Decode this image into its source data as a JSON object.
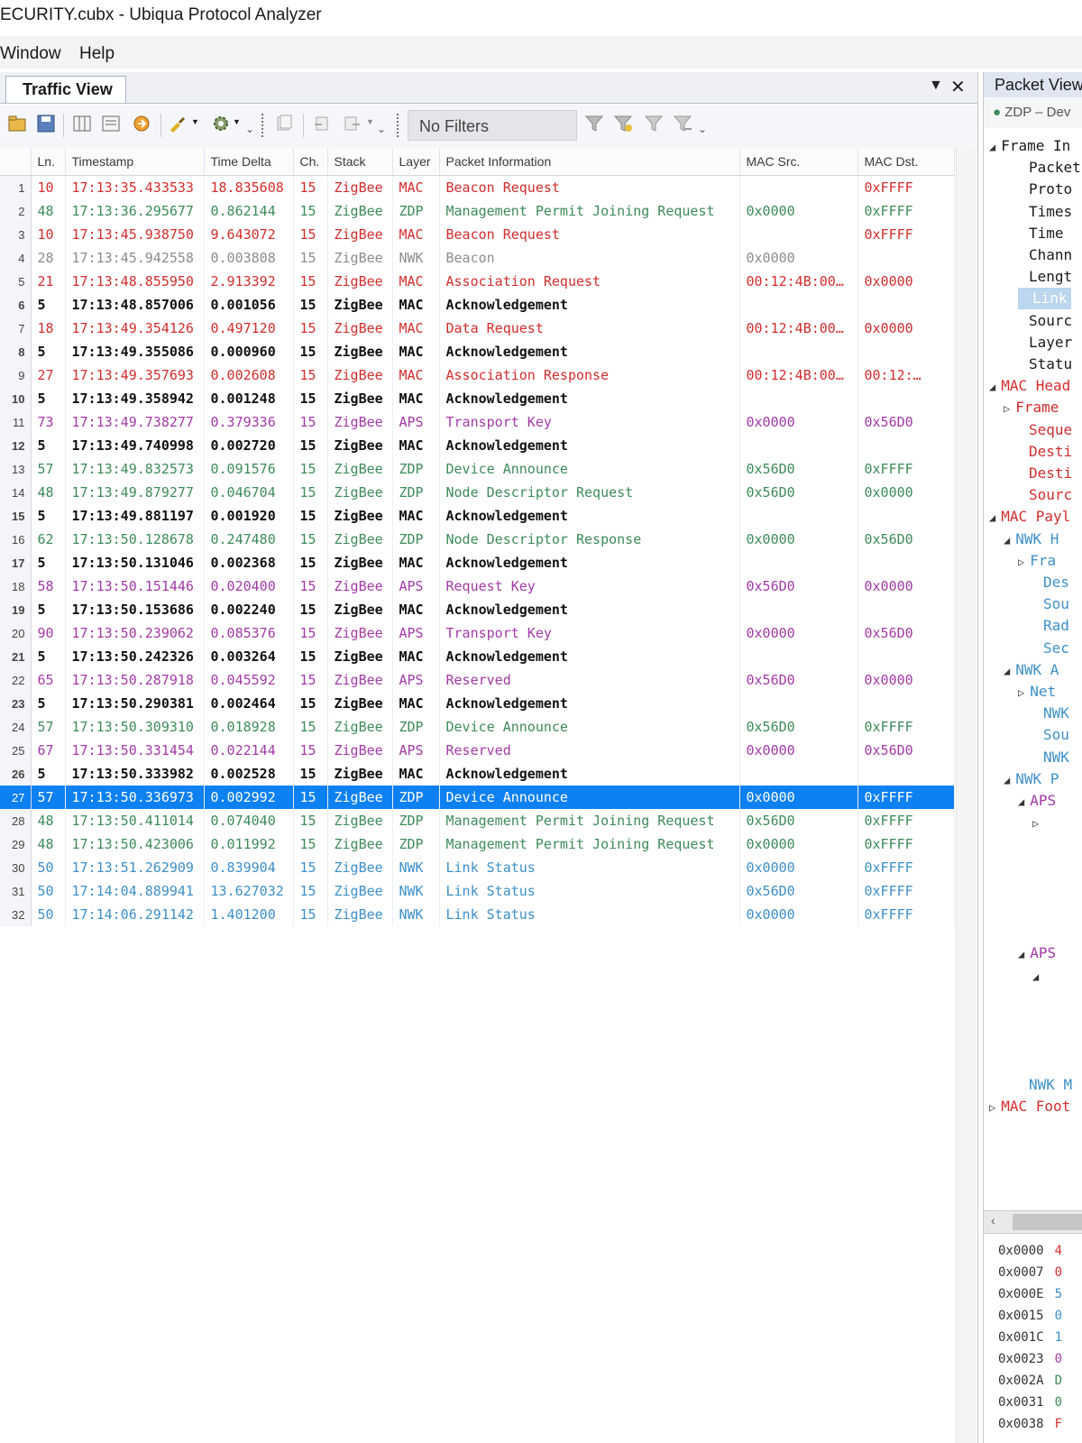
{
  "window": {
    "title": "ECURITY.cubx - Ubiqua Protocol Analyzer"
  },
  "menu": {
    "items": [
      "Window",
      "Help"
    ]
  },
  "traffic_view": {
    "tab_label": "Traffic View",
    "filter_placeholder": "No Filters",
    "columns": [
      "Ln.",
      "Timestamp",
      "Time Delta",
      "Ch.",
      "Stack",
      "Layer",
      "Packet Information",
      "MAC Src.",
      "MAC Dst."
    ],
    "rows": [
      {
        "n": "1",
        "len": "10",
        "ts": "17:13:35.433533",
        "delta": "18.835608",
        "ch": "15",
        "stack": "ZigBee",
        "layer": "MAC",
        "info": "Beacon Request",
        "src": "",
        "dst": "0xFFFF",
        "color": "red"
      },
      {
        "n": "2",
        "len": "48",
        "ts": "17:13:36.295677",
        "delta": "0.862144",
        "ch": "15",
        "stack": "ZigBee",
        "layer": "ZDP",
        "info": "Management Permit Joining Request",
        "src": "0x0000",
        "dst": "0xFFFF",
        "color": "green"
      },
      {
        "n": "3",
        "len": "10",
        "ts": "17:13:45.938750",
        "delta": "9.643072",
        "ch": "15",
        "stack": "ZigBee",
        "layer": "MAC",
        "info": "Beacon Request",
        "src": "",
        "dst": "0xFFFF",
        "color": "red"
      },
      {
        "n": "4",
        "len": "28",
        "ts": "17:13:45.942558",
        "delta": "0.003808",
        "ch": "15",
        "stack": "ZigBee",
        "layer": "NWK",
        "info": "Beacon",
        "src": "0x0000",
        "dst": "",
        "color": "gray"
      },
      {
        "n": "5",
        "len": "21",
        "ts": "17:13:48.855950",
        "delta": "2.913392",
        "ch": "15",
        "stack": "ZigBee",
        "layer": "MAC",
        "info": "Association Request",
        "src": "00:12:4B:00…",
        "dst": "0x0000",
        "color": "red"
      },
      {
        "n": "6",
        "len": "5",
        "ts": "17:13:48.857006",
        "delta": "0.001056",
        "ch": "15",
        "stack": "ZigBee",
        "layer": "MAC",
        "info": "Acknowledgement",
        "src": "",
        "dst": "",
        "color": "black"
      },
      {
        "n": "7",
        "len": "18",
        "ts": "17:13:49.354126",
        "delta": "0.497120",
        "ch": "15",
        "stack": "ZigBee",
        "layer": "MAC",
        "info": "Data Request",
        "src": "00:12:4B:00…",
        "dst": "0x0000",
        "color": "red"
      },
      {
        "n": "8",
        "len": "5",
        "ts": "17:13:49.355086",
        "delta": "0.000960",
        "ch": "15",
        "stack": "ZigBee",
        "layer": "MAC",
        "info": "Acknowledgement",
        "src": "",
        "dst": "",
        "color": "black"
      },
      {
        "n": "9",
        "len": "27",
        "ts": "17:13:49.357693",
        "delta": "0.002608",
        "ch": "15",
        "stack": "ZigBee",
        "layer": "MAC",
        "info": "Association Response",
        "src": "00:12:4B:00…",
        "dst": "00:12:…",
        "color": "red"
      },
      {
        "n": "10",
        "len": "5",
        "ts": "17:13:49.358942",
        "delta": "0.001248",
        "ch": "15",
        "stack": "ZigBee",
        "layer": "MAC",
        "info": "Acknowledgement",
        "src": "",
        "dst": "",
        "color": "black"
      },
      {
        "n": "11",
        "len": "73",
        "ts": "17:13:49.738277",
        "delta": "0.379336",
        "ch": "15",
        "stack": "ZigBee",
        "layer": "APS",
        "info": "Transport Key",
        "src": "0x0000",
        "dst": "0x56D0",
        "color": "purple"
      },
      {
        "n": "12",
        "len": "5",
        "ts": "17:13:49.740998",
        "delta": "0.002720",
        "ch": "15",
        "stack": "ZigBee",
        "layer": "MAC",
        "info": "Acknowledgement",
        "src": "",
        "dst": "",
        "color": "black"
      },
      {
        "n": "13",
        "len": "57",
        "ts": "17:13:49.832573",
        "delta": "0.091576",
        "ch": "15",
        "stack": "ZigBee",
        "layer": "ZDP",
        "info": "Device Announce",
        "src": "0x56D0",
        "dst": "0xFFFF",
        "color": "green"
      },
      {
        "n": "14",
        "len": "48",
        "ts": "17:13:49.879277",
        "delta": "0.046704",
        "ch": "15",
        "stack": "ZigBee",
        "layer": "ZDP",
        "info": "Node Descriptor Request",
        "src": "0x56D0",
        "dst": "0x0000",
        "color": "green"
      },
      {
        "n": "15",
        "len": "5",
        "ts": "17:13:49.881197",
        "delta": "0.001920",
        "ch": "15",
        "stack": "ZigBee",
        "layer": "MAC",
        "info": "Acknowledgement",
        "src": "",
        "dst": "",
        "color": "black"
      },
      {
        "n": "16",
        "len": "62",
        "ts": "17:13:50.128678",
        "delta": "0.247480",
        "ch": "15",
        "stack": "ZigBee",
        "layer": "ZDP",
        "info": "Node Descriptor Response",
        "src": "0x0000",
        "dst": "0x56D0",
        "color": "green"
      },
      {
        "n": "17",
        "len": "5",
        "ts": "17:13:50.131046",
        "delta": "0.002368",
        "ch": "15",
        "stack": "ZigBee",
        "layer": "MAC",
        "info": "Acknowledgement",
        "src": "",
        "dst": "",
        "color": "black"
      },
      {
        "n": "18",
        "len": "58",
        "ts": "17:13:50.151446",
        "delta": "0.020400",
        "ch": "15",
        "stack": "ZigBee",
        "layer": "APS",
        "info": "Request Key",
        "src": "0x56D0",
        "dst": "0x0000",
        "color": "purple"
      },
      {
        "n": "19",
        "len": "5",
        "ts": "17:13:50.153686",
        "delta": "0.002240",
        "ch": "15",
        "stack": "ZigBee",
        "layer": "MAC",
        "info": "Acknowledgement",
        "src": "",
        "dst": "",
        "color": "black"
      },
      {
        "n": "20",
        "len": "90",
        "ts": "17:13:50.239062",
        "delta": "0.085376",
        "ch": "15",
        "stack": "ZigBee",
        "layer": "APS",
        "info": "Transport Key",
        "src": "0x0000",
        "dst": "0x56D0",
        "color": "purple"
      },
      {
        "n": "21",
        "len": "5",
        "ts": "17:13:50.242326",
        "delta": "0.003264",
        "ch": "15",
        "stack": "ZigBee",
        "layer": "MAC",
        "info": "Acknowledgement",
        "src": "",
        "dst": "",
        "color": "black"
      },
      {
        "n": "22",
        "len": "65",
        "ts": "17:13:50.287918",
        "delta": "0.045592",
        "ch": "15",
        "stack": "ZigBee",
        "layer": "APS",
        "info": "Reserved",
        "src": "0x56D0",
        "dst": "0x0000",
        "color": "purple"
      },
      {
        "n": "23",
        "len": "5",
        "ts": "17:13:50.290381",
        "delta": "0.002464",
        "ch": "15",
        "stack": "ZigBee",
        "layer": "MAC",
        "info": "Acknowledgement",
        "src": "",
        "dst": "",
        "color": "black"
      },
      {
        "n": "24",
        "len": "57",
        "ts": "17:13:50.309310",
        "delta": "0.018928",
        "ch": "15",
        "stack": "ZigBee",
        "layer": "ZDP",
        "info": "Device Announce",
        "src": "0x56D0",
        "dst": "0xFFFF",
        "color": "green"
      },
      {
        "n": "25",
        "len": "67",
        "ts": "17:13:50.331454",
        "delta": "0.022144",
        "ch": "15",
        "stack": "ZigBee",
        "layer": "APS",
        "info": "Reserved",
        "src": "0x0000",
        "dst": "0x56D0",
        "color": "purple"
      },
      {
        "n": "26",
        "len": "5",
        "ts": "17:13:50.333982",
        "delta": "0.002528",
        "ch": "15",
        "stack": "ZigBee",
        "layer": "MAC",
        "info": "Acknowledgement",
        "src": "",
        "dst": "",
        "color": "black"
      },
      {
        "n": "27",
        "len": "57",
        "ts": "17:13:50.336973",
        "delta": "0.002992",
        "ch": "15",
        "stack": "ZigBee",
        "layer": "ZDP",
        "info": "Device Announce",
        "src": "0x0000",
        "dst": "0xFFFF",
        "color": "green",
        "selected": true
      },
      {
        "n": "28",
        "len": "48",
        "ts": "17:13:50.411014",
        "delta": "0.074040",
        "ch": "15",
        "stack": "ZigBee",
        "layer": "ZDP",
        "info": "Management Permit Joining Request",
        "src": "0x56D0",
        "dst": "0xFFFF",
        "color": "green"
      },
      {
        "n": "29",
        "len": "48",
        "ts": "17:13:50.423006",
        "delta": "0.011992",
        "ch": "15",
        "stack": "ZigBee",
        "layer": "ZDP",
        "info": "Management Permit Joining Request",
        "src": "0x0000",
        "dst": "0xFFFF",
        "color": "green"
      },
      {
        "n": "30",
        "len": "50",
        "ts": "17:13:51.262909",
        "delta": "0.839904",
        "ch": "15",
        "stack": "ZigBee",
        "layer": "NWK",
        "info": "Link Status",
        "src": "0x0000",
        "dst": "0xFFFF",
        "color": "blue"
      },
      {
        "n": "31",
        "len": "50",
        "ts": "17:14:04.889941",
        "delta": "13.627032",
        "ch": "15",
        "stack": "ZigBee",
        "layer": "NWK",
        "info": "Link Status",
        "src": "0x56D0",
        "dst": "0xFFFF",
        "color": "blue"
      },
      {
        "n": "32",
        "len": "50",
        "ts": "17:14:06.291142",
        "delta": "1.401200",
        "ch": "15",
        "stack": "ZigBee",
        "layer": "NWK",
        "info": "Link Status",
        "src": "0x0000",
        "dst": "0xFFFF",
        "color": "blue"
      }
    ]
  },
  "packet_view": {
    "title": "Packet View",
    "subtitle": "ZDP – Dev",
    "tree": [
      {
        "text": "Frame In",
        "arrow": "◢",
        "indent": 0,
        "color": "#1a1a1a"
      },
      {
        "text": "Packet",
        "indent": 2,
        "color": "#1a1a1a"
      },
      {
        "text": "Proto",
        "indent": 2,
        "color": "#1a1a1a"
      },
      {
        "text": "Times",
        "indent": 2,
        "color": "#1a1a1a"
      },
      {
        "text": "Time",
        "indent": 2,
        "color": "#1a1a1a"
      },
      {
        "text": "Chann",
        "indent": 2,
        "color": "#1a1a1a"
      },
      {
        "text": "Lengt",
        "indent": 2,
        "color": "#1a1a1a"
      },
      {
        "text": "Link",
        "indent": 2,
        "color": "#ffffff",
        "highlight": true
      },
      {
        "text": "Sourc",
        "indent": 2,
        "color": "#1a1a1a"
      },
      {
        "text": "Layer",
        "indent": 2,
        "color": "#1a1a1a"
      },
      {
        "text": "Statu",
        "indent": 2,
        "color": "#1a1a1a"
      },
      {
        "text": "MAC Head",
        "arrow": "◢",
        "indent": 0,
        "color": "#d32d2d"
      },
      {
        "text": "Frame",
        "arrow": "▷",
        "indent": 1,
        "color": "#d32d2d"
      },
      {
        "text": "Seque",
        "indent": 2,
        "color": "#d32d2d"
      },
      {
        "text": "Desti",
        "indent": 2,
        "color": "#d32d2d"
      },
      {
        "text": "Desti",
        "indent": 2,
        "color": "#d32d2d"
      },
      {
        "text": "Sourc",
        "indent": 2,
        "color": "#d32d2d"
      },
      {
        "text": "MAC Payl",
        "arrow": "◢",
        "indent": 0,
        "color": "#d32d2d"
      },
      {
        "text": "NWK H",
        "arrow": "◢",
        "indent": 1,
        "color": "#3d8fc9"
      },
      {
        "text": "Fra",
        "arrow": "▷",
        "indent": 2,
        "color": "#3d8fc9"
      },
      {
        "text": "Des",
        "indent": 3,
        "color": "#3d8fc9"
      },
      {
        "text": "Sou",
        "indent": 3,
        "color": "#3d8fc9"
      },
      {
        "text": "Rad",
        "indent": 3,
        "color": "#3d8fc9"
      },
      {
        "text": "Sec",
        "indent": 3,
        "color": "#3d8fc9"
      },
      {
        "text": "NWK A",
        "arrow": "◢",
        "indent": 1,
        "color": "#3d8fc9"
      },
      {
        "text": "Net",
        "arrow": "▷",
        "indent": 2,
        "color": "#3d8fc9"
      },
      {
        "text": "NWK",
        "indent": 3,
        "color": "#3d8fc9"
      },
      {
        "text": "Sou",
        "indent": 3,
        "color": "#3d8fc9"
      },
      {
        "text": "NWK",
        "indent": 3,
        "color": "#3d8fc9"
      },
      {
        "text": "NWK P",
        "arrow": "◢",
        "indent": 1,
        "color": "#3d8fc9"
      },
      {
        "text": "APS",
        "arrow": "◢",
        "indent": 2,
        "color": "#a23aa6"
      },
      {
        "text": "",
        "arrow": "▷",
        "indent": 3,
        "color": "#a23aa6"
      },
      {
        "text": "",
        "indent": 3,
        "color": "#a23aa6"
      },
      {
        "text": "",
        "indent": 3,
        "color": "#a23aa6"
      },
      {
        "text": "",
        "indent": 3,
        "color": "#a23aa6"
      },
      {
        "text": "",
        "indent": 3,
        "color": "#a23aa6"
      },
      {
        "text": "",
        "indent": 3,
        "color": "#a23aa6"
      },
      {
        "text": "APS",
        "arrow": "◢",
        "indent": 2,
        "color": "#a23aa6"
      },
      {
        "text": "",
        "arrow": "◢",
        "indent": 3,
        "color": "#a23aa6"
      },
      {
        "text": "",
        "indent": 3,
        "color": "#a23aa6"
      },
      {
        "text": "",
        "indent": 3,
        "color": "#a23aa6"
      },
      {
        "text": "",
        "indent": 3,
        "color": "#a23aa6"
      },
      {
        "text": "",
        "indent": 3,
        "color": "#a23aa6"
      },
      {
        "text": "NWK M",
        "indent": 2,
        "color": "#3d8fc9"
      },
      {
        "text": "MAC Foot",
        "arrow": "▷",
        "indent": 0,
        "color": "#d32d2d"
      }
    ],
    "hex": [
      {
        "addr": "0x0000",
        "data": "4",
        "color": "#d32d2d"
      },
      {
        "addr": "0x0007",
        "data": "0",
        "color": "#d32d2d"
      },
      {
        "addr": "0x000E",
        "data": "5",
        "color": "#3d8fc9"
      },
      {
        "addr": "0x0015",
        "data": "0",
        "color": "#3d8fc9"
      },
      {
        "addr": "0x001C",
        "data": "1",
        "color": "#3d8fc9"
      },
      {
        "addr": "0x0023",
        "data": "0",
        "color": "#a23aa6"
      },
      {
        "addr": "0x002A",
        "data": "D",
        "color": "#3d8b5a"
      },
      {
        "addr": "0x0031",
        "data": "0",
        "color": "#3d8b5a"
      },
      {
        "addr": "0x0038",
        "data": "F",
        "color": "#d32d2d"
      }
    ]
  },
  "colors": {
    "red": "#d32d2d",
    "green": "#3d8b5a",
    "black": "#111111",
    "gray": "#8c8c8c",
    "purple": "#a23aa6",
    "blue": "#3d8fc9",
    "selection": "#0d80f2"
  }
}
